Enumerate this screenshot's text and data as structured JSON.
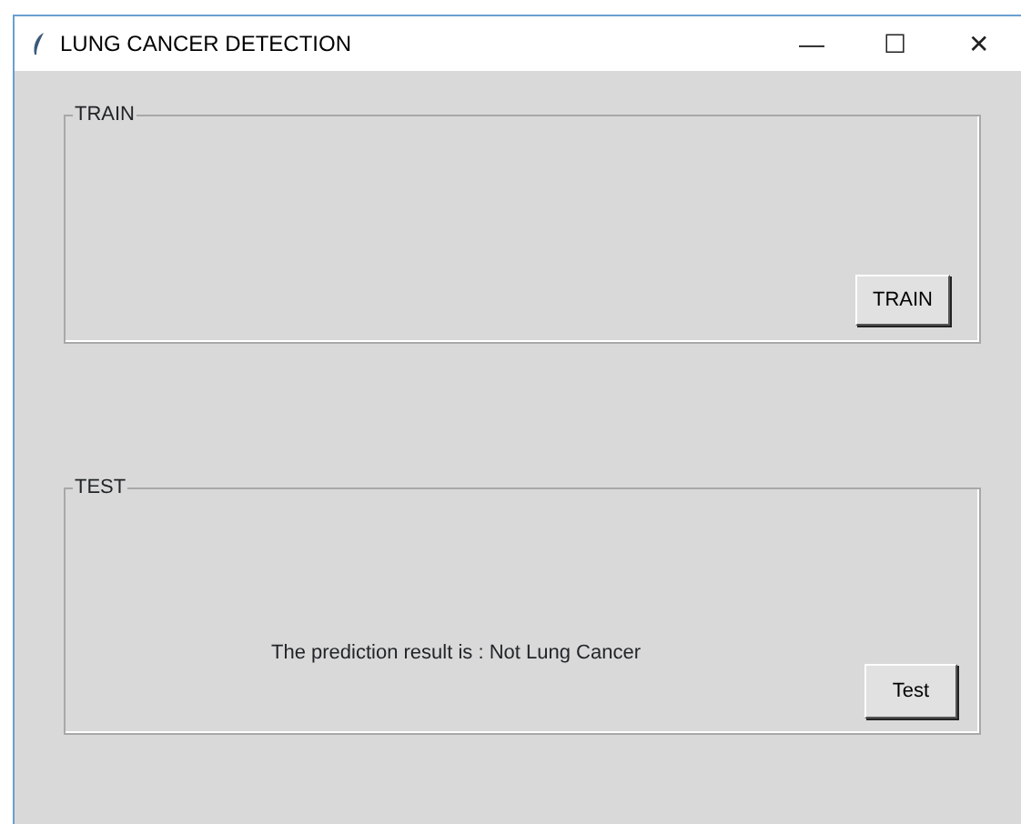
{
  "window": {
    "title": "LUNG CANCER DETECTION",
    "controls": [
      "—",
      "☐",
      "✕"
    ]
  },
  "frames": [
    {
      "legend": "TRAIN",
      "button": "TRAIN"
    },
    {
      "legend": "TEST",
      "result": "The prediction result is : Not Lung Cancer",
      "button": "Test"
    }
  ]
}
